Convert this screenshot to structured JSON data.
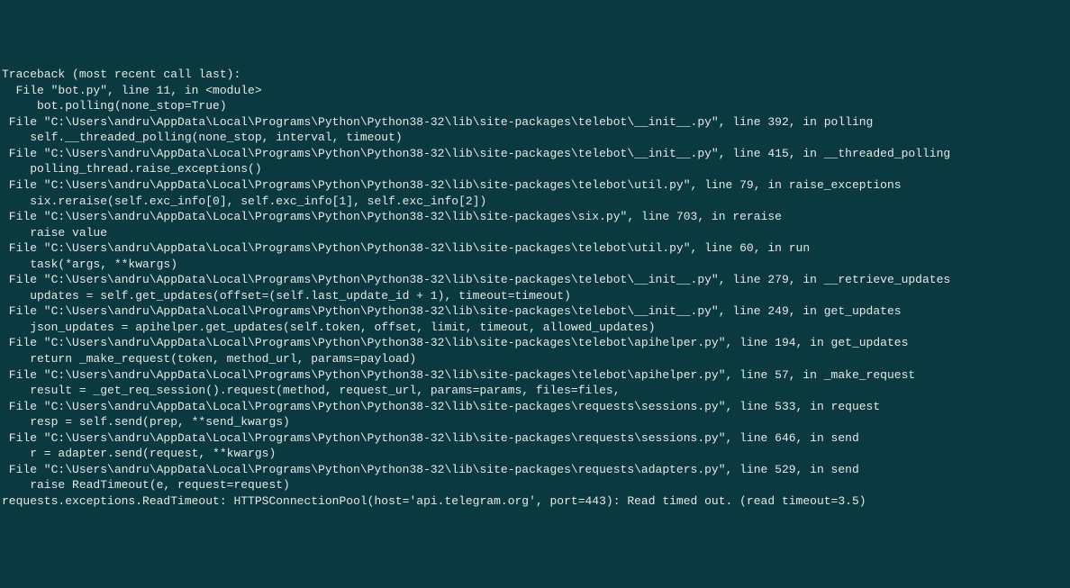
{
  "traceback": {
    "header": "Traceback (most recent call last):",
    "frames": [
      {
        "location": "  File \"bot.py\", line 11, in <module>",
        "code": "     bot.polling(none_stop=True)"
      },
      {
        "location": " File \"C:\\Users\\andru\\AppData\\Local\\Programs\\Python\\Python38-32\\lib\\site-packages\\telebot\\__init__.py\", line 392, in polling",
        "code": "    self.__threaded_polling(none_stop, interval, timeout)"
      },
      {
        "location": " File \"C:\\Users\\andru\\AppData\\Local\\Programs\\Python\\Python38-32\\lib\\site-packages\\telebot\\__init__.py\", line 415, in __threaded_polling",
        "code": "    polling_thread.raise_exceptions()"
      },
      {
        "location": " File \"C:\\Users\\andru\\AppData\\Local\\Programs\\Python\\Python38-32\\lib\\site-packages\\telebot\\util.py\", line 79, in raise_exceptions",
        "code": "    six.reraise(self.exc_info[0], self.exc_info[1], self.exc_info[2])"
      },
      {
        "location": " File \"C:\\Users\\andru\\AppData\\Local\\Programs\\Python\\Python38-32\\lib\\site-packages\\six.py\", line 703, in reraise",
        "code": "    raise value"
      },
      {
        "location": " File \"C:\\Users\\andru\\AppData\\Local\\Programs\\Python\\Python38-32\\lib\\site-packages\\telebot\\util.py\", line 60, in run",
        "code": "    task(*args, **kwargs)"
      },
      {
        "location": " File \"C:\\Users\\andru\\AppData\\Local\\Programs\\Python\\Python38-32\\lib\\site-packages\\telebot\\__init__.py\", line 279, in __retrieve_updates",
        "code": "    updates = self.get_updates(offset=(self.last_update_id + 1), timeout=timeout)"
      },
      {
        "location": " File \"C:\\Users\\andru\\AppData\\Local\\Programs\\Python\\Python38-32\\lib\\site-packages\\telebot\\__init__.py\", line 249, in get_updates",
        "code": "    json_updates = apihelper.get_updates(self.token, offset, limit, timeout, allowed_updates)"
      },
      {
        "location": " File \"C:\\Users\\andru\\AppData\\Local\\Programs\\Python\\Python38-32\\lib\\site-packages\\telebot\\apihelper.py\", line 194, in get_updates",
        "code": "    return _make_request(token, method_url, params=payload)"
      },
      {
        "location": " File \"C:\\Users\\andru\\AppData\\Local\\Programs\\Python\\Python38-32\\lib\\site-packages\\telebot\\apihelper.py\", line 57, in _make_request",
        "code": "    result = _get_req_session().request(method, request_url, params=params, files=files,"
      },
      {
        "location": " File \"C:\\Users\\andru\\AppData\\Local\\Programs\\Python\\Python38-32\\lib\\site-packages\\requests\\sessions.py\", line 533, in request",
        "code": "    resp = self.send(prep, **send_kwargs)"
      },
      {
        "location": " File \"C:\\Users\\andru\\AppData\\Local\\Programs\\Python\\Python38-32\\lib\\site-packages\\requests\\sessions.py\", line 646, in send",
        "code": "    r = adapter.send(request, **kwargs)"
      },
      {
        "location": " File \"C:\\Users\\andru\\AppData\\Local\\Programs\\Python\\Python38-32\\lib\\site-packages\\requests\\adapters.py\", line 529, in send",
        "code": "    raise ReadTimeout(e, request=request)"
      }
    ],
    "exception": "requests.exceptions.ReadTimeout: HTTPSConnectionPool(host='api.telegram.org', port=443): Read timed out. (read timeout=3.5)"
  }
}
